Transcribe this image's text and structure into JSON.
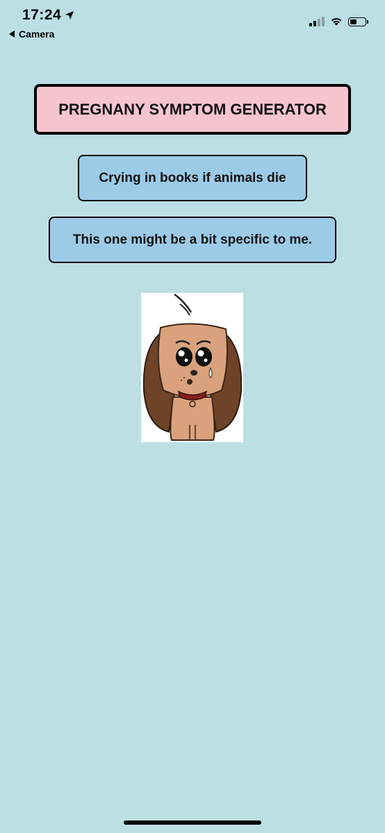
{
  "status_bar": {
    "time": "17:24",
    "back_label": "Camera",
    "battery_level": 0.45,
    "signal_bars": 2
  },
  "main": {
    "title": "PREGNANY SYMPTOM GENERATOR",
    "symptom": "Crying in books if animals die",
    "note": "This one might be a bit specific to me.",
    "image_icon": "sad-puppy-cartoon"
  },
  "colors": {
    "background": "#bcdfe4",
    "title_bg": "#f5c4cf",
    "button_bg": "#9ccbe8"
  }
}
